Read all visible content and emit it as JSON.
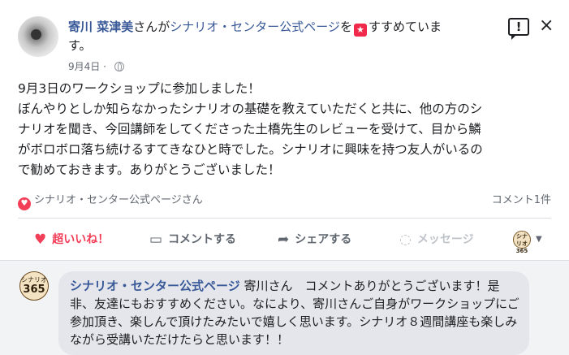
{
  "post": {
    "author": "寄川 菜津美",
    "recommend_prefix": "さんが",
    "page_name": "シナリオ・センター公式ページ",
    "recommend_middle": "を",
    "star_icon": "★",
    "recommend_suffix": "すすめていま",
    "recommend_suffix2": "す。",
    "date": "9月4日",
    "dot": "·",
    "body": "9月3日のワークショップに参加しました！\nぼんやりとしか知らなかったシナリオの基礎を教えていただくと共に、他の方のシ\nナリオを聞き、今回講師をしてくださった土橋先生のレビューを受けて、目から鱗\nがボロボロ落ち続けるすてきなひと時でした。シナリオに興味を持つ友人がいるの\nで勧めておきます。ありがとうございました！",
    "report_icon_glyph": "!",
    "close_icon_glyph": "×"
  },
  "reactions": {
    "heart_glyph": "♥",
    "reactors": "シナリオ・センター公式ページさん",
    "comment_count": "コメント1件"
  },
  "actions": {
    "like_label": "超いいね！",
    "comment_label": "コメントする",
    "share_label": "シェアする",
    "message_label": "メッセージ",
    "like_icon": "heart-icon",
    "comment_icon": "speech-bubble-icon",
    "share_icon": "share-arrow-icon",
    "message_icon": "messenger-icon"
  },
  "comment": {
    "logo_line1": "シナリオ",
    "logo_line2": "365",
    "commenter": "シナリオ・センター公式ページ",
    "text": " 寄川さん　コメントありがとうございます！是非、友達にもおすすめください。なにより、寄川さんご自身がワークショップにご参加頂き、楽しんで頂けたみたいで嬉しく思います。シナリオ８週間講座も楽しみながら受講いただけたらと思います！！"
  },
  "colors": {
    "link": "#385898",
    "like_red": "#f33e58",
    "comment_bg": "#e4e6eb",
    "secondary_text": "#616770"
  }
}
